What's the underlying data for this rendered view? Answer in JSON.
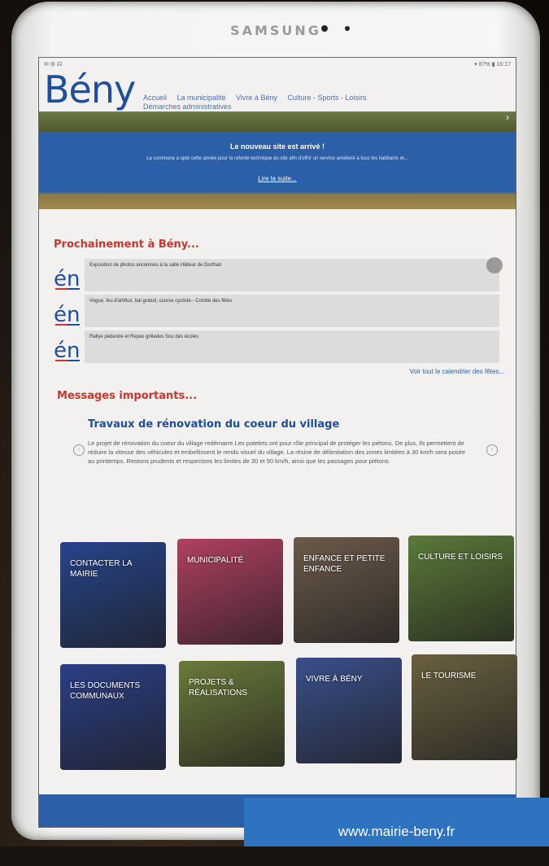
{
  "device": {
    "brand": "SAMSUNG"
  },
  "statusbar": {
    "left": "✉ ⚙ ☊",
    "right": "▾ 87% ▮ 16:17"
  },
  "site": {
    "logo": "Bény",
    "nav": [
      "Accueil",
      "La municipalité",
      "Vivre à Bény",
      "Culture - Sports - Loisirs",
      "Démarches administratives"
    ]
  },
  "news": {
    "title": "Le nouveau site est arrivé !",
    "text": "La commune a opté cette année pour la refonte technique du site afin d'offrir un service amélioré à tous les habitants et...",
    "link": "Lire la suite..."
  },
  "upcoming": {
    "title": "Prochainement à Bény...",
    "events": [
      {
        "icon": "én",
        "text": "Exposition de photos anciennes à la salle Hâtieur de Dorthan"
      },
      {
        "icon": "én",
        "text": "Vogue, feu d'artifice, bal gratuit, course cycliste - Comité des fêtes"
      },
      {
        "icon": "én",
        "text": "Rallye pédestre et Repas grillades Sou des écoles"
      }
    ],
    "calendar_link": "Voir tout le calendrier des fêtes..."
  },
  "messages": {
    "title": "Messages importants...",
    "item_title": "Travaux de rénovation du coeur du village",
    "item_body": "Le projet de rénovation du coeur du village redémarre.Les potelets ont pour rôle principal de protéger les piétons. De plus, ils permettent de réduire la vitesse des véhicules et embellissent le rendu visuel du village. La résine de délimitation des zones limitées à 30 km/h sera posée au printemps. Restons prudents et respectons les limites de 30 et 50 km/h, ainsi que les passages pour piétons."
  },
  "tiles": [
    {
      "label": "CONTACTER LA MAIRIE",
      "color": "#27448a"
    },
    {
      "label": "MUNICIPALITÉ",
      "color": "#b04060"
    },
    {
      "label": "ENFANCE ET PETITE ENFANCE",
      "color": "#6c5a4a"
    },
    {
      "label": "CULTURE ET LOISIRS",
      "color": "#5a7a38"
    },
    {
      "label": "LES DOCUMENTS COMMUNAUX",
      "color": "#2b3f85"
    },
    {
      "label": "PROJETS & RÉALISATIONS",
      "color": "#6a7a3a"
    },
    {
      "label": "VIVRE À BÉNY",
      "color": "#3a4f8a"
    },
    {
      "label": "LE TOURISME",
      "color": "#6a6040"
    }
  ],
  "banner": {
    "url": "www.mairie-beny.fr"
  },
  "colors": {
    "accent": "#1e4ea0",
    "red": "#c8372d",
    "banner": "#2d73bf"
  }
}
